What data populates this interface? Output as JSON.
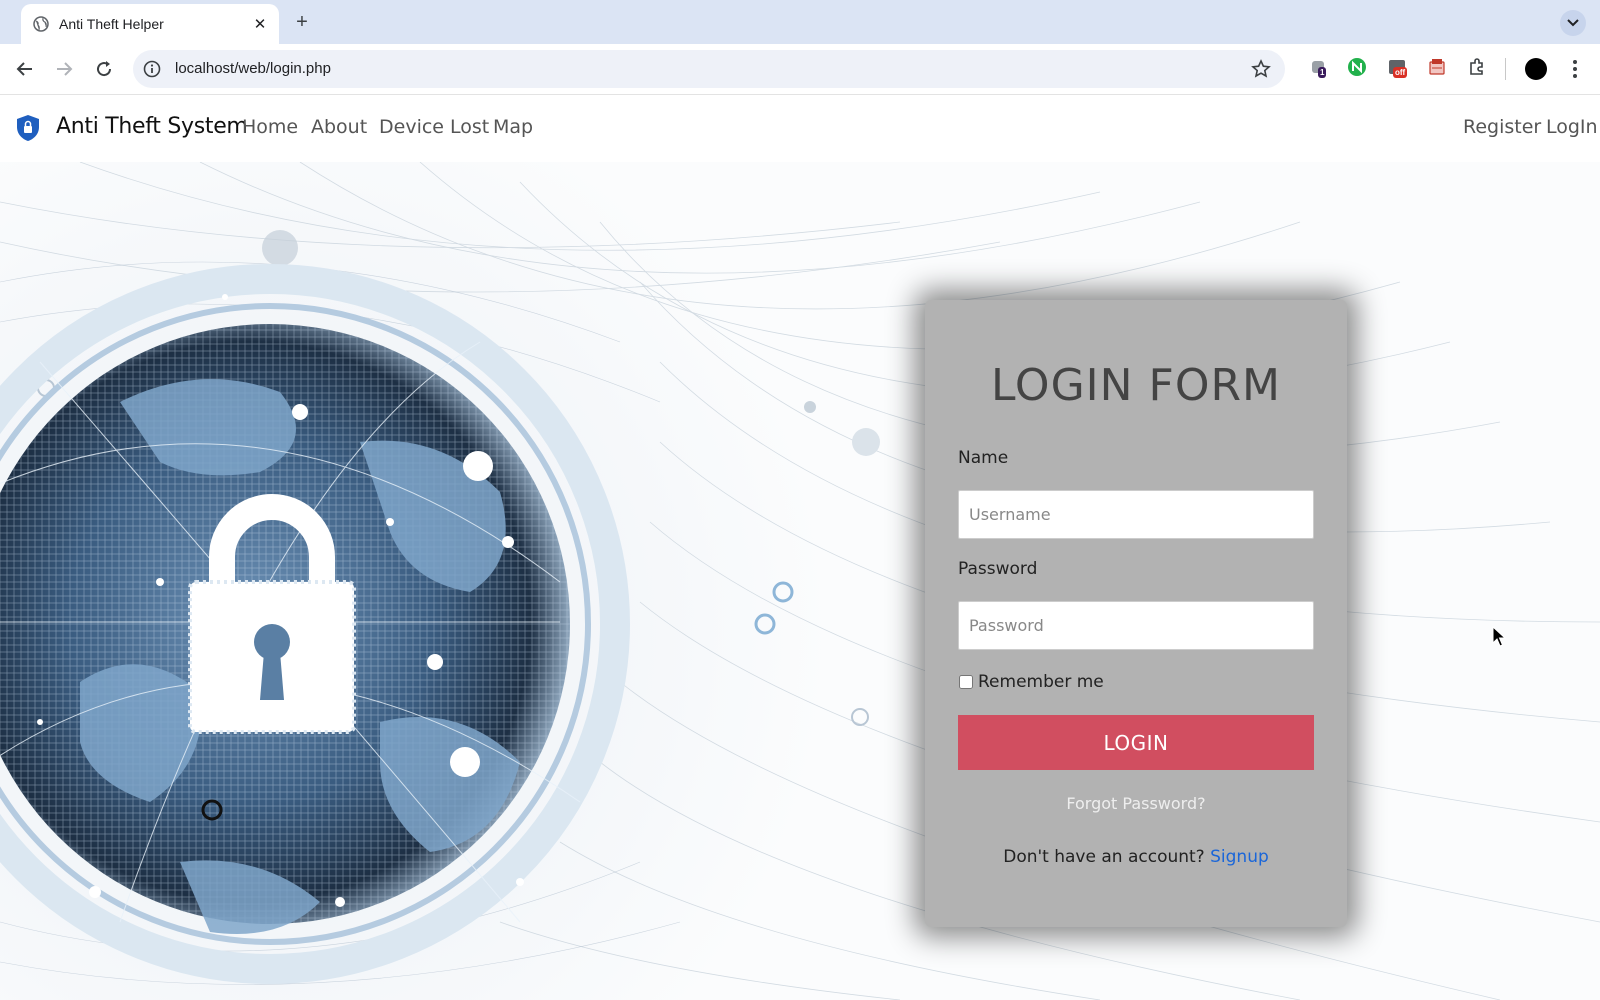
{
  "browser": {
    "tab_title": "Anti Theft Helper",
    "tab_close": "✕",
    "new_tab": "+",
    "url": "localhost/web/login.php",
    "extensions": [
      {
        "name": "extension-badge-1",
        "badge": "1"
      },
      {
        "name": "extension-green"
      },
      {
        "name": "extension-off",
        "badge": "off"
      },
      {
        "name": "extension-red"
      }
    ]
  },
  "navbar": {
    "brand": "Anti Theft System",
    "links": [
      "Home",
      "About",
      "Device Lost",
      "Map"
    ],
    "right_links": [
      "Register",
      "LogIn"
    ]
  },
  "login": {
    "title": "LOGIN FORM",
    "name_label": "Name",
    "username_placeholder": "Username",
    "password_label": "Password",
    "password_placeholder": "Password",
    "remember_label": "Remember me",
    "remember_checked": false,
    "login_button": "LOGIN",
    "forgot": "Forgot Password?",
    "no_account": "Don't have an account?",
    "signup": "Signup"
  },
  "colors": {
    "card_bg": "#b2b2b2",
    "login_button": "#d14e60",
    "signup_link": "#1a66d9",
    "tabbar": "#dbe4f4"
  }
}
